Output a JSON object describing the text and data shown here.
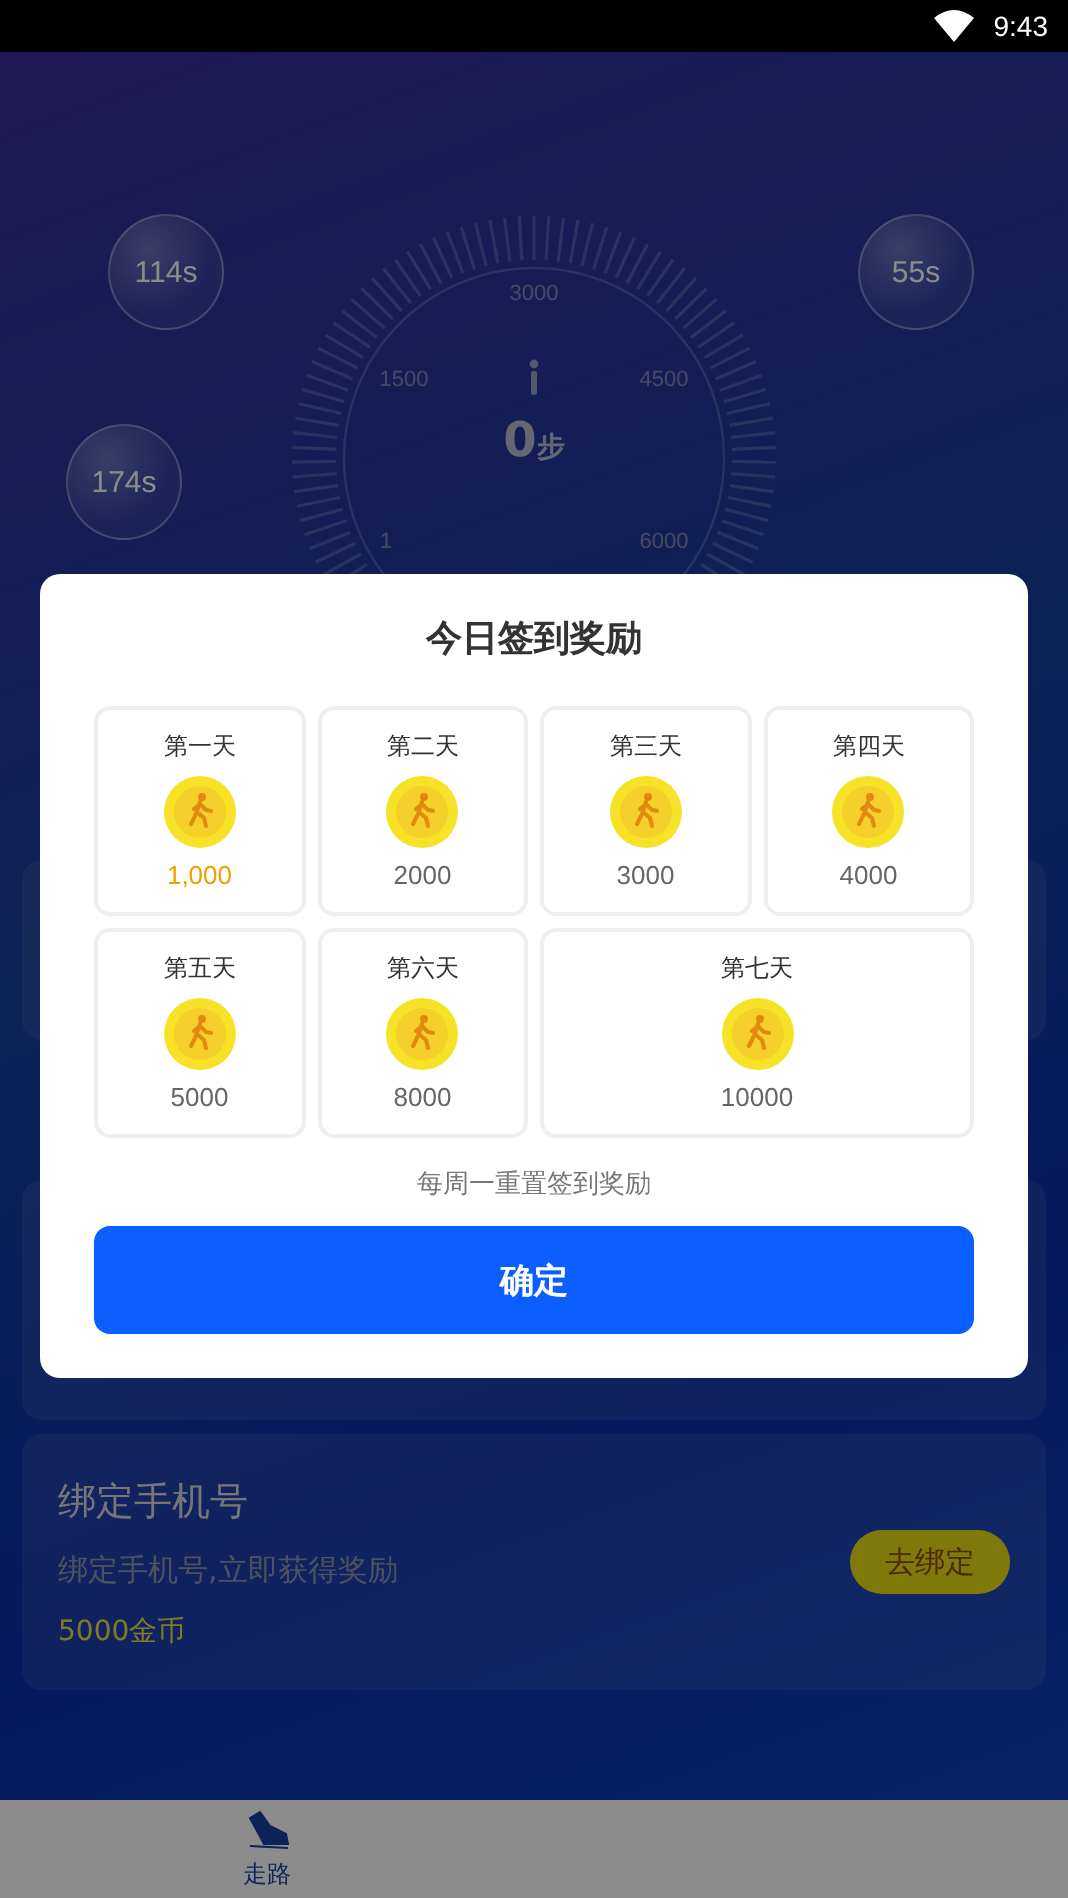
{
  "status_bar": {
    "time": "9:43"
  },
  "bubbles": [
    {
      "label": "114s"
    },
    {
      "label": "55s"
    },
    {
      "label": "174s"
    }
  ],
  "gauge": {
    "scale_labels": [
      "3000",
      "1500",
      "4500",
      "1",
      "6000"
    ],
    "steps": "0",
    "unit": "步"
  },
  "task_cards": [
    {
      "title": "绑定手机号",
      "description": "绑定手机号,立即获得奖励",
      "reward": "5000金币",
      "button": "去绑定"
    }
  ],
  "bottom_nav": [
    {
      "label": "走路",
      "selected": true
    }
  ],
  "dialog": {
    "title": "今日签到奖励",
    "days": [
      {
        "label": "第一天",
        "reward": "1,000",
        "today": true
      },
      {
        "label": "第二天",
        "reward": "2000",
        "today": false
      },
      {
        "label": "第三天",
        "reward": "3000",
        "today": false
      },
      {
        "label": "第四天",
        "reward": "4000",
        "today": false
      },
      {
        "label": "第五天",
        "reward": "5000",
        "today": false
      },
      {
        "label": "第六天",
        "reward": "8000",
        "today": false
      },
      {
        "label": "第七天",
        "reward": "10000",
        "today": false
      }
    ],
    "note": "每周一重置签到奖励",
    "confirm_button": "确定"
  }
}
